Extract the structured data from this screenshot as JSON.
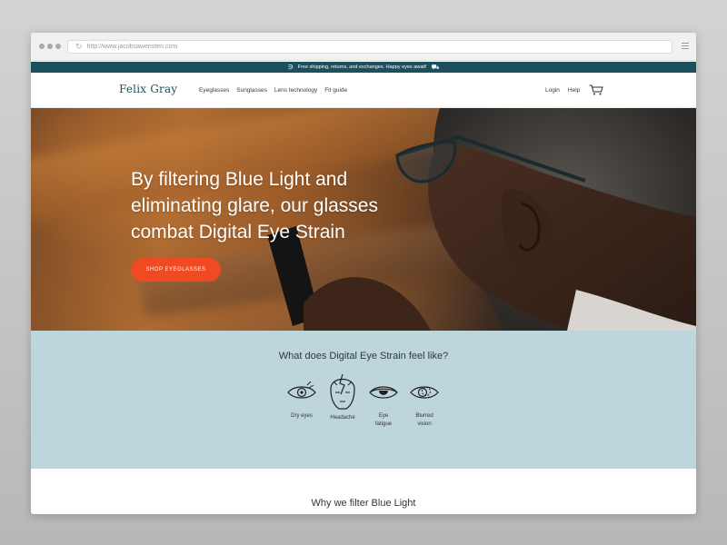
{
  "browser": {
    "url": "http://www.jacobsawensten.com"
  },
  "promo": {
    "text": "Free shipping, returns, and exchanges. Happy eyes await!"
  },
  "nav": {
    "logo": "Felix Gray",
    "links": [
      "Eyeglasses",
      "Sunglasses",
      "Lens technology",
      "Fit guide"
    ],
    "login": "Login",
    "help": "Help"
  },
  "hero": {
    "title": "By filtering Blue Light and eliminating glare, our glasses combat Digital Eye Strain",
    "button": "SHOP EYEGLASSES"
  },
  "symptoms": {
    "title": "What does Digital Eye Strain feel like?",
    "items": [
      {
        "label": "Dry eyes",
        "icon": "dry-eye-icon"
      },
      {
        "label": "Headache",
        "icon": "headache-icon"
      },
      {
        "label": "Eye fatigue",
        "icon": "eye-fatigue-icon"
      },
      {
        "label": "Blurred vision",
        "icon": "blurred-vision-icon"
      }
    ]
  },
  "why": {
    "title": "Why we filter Blue Light"
  },
  "colors": {
    "brand": "#1d4f5c",
    "accent": "#f04a23",
    "section_bg": "#bcd6dc"
  }
}
